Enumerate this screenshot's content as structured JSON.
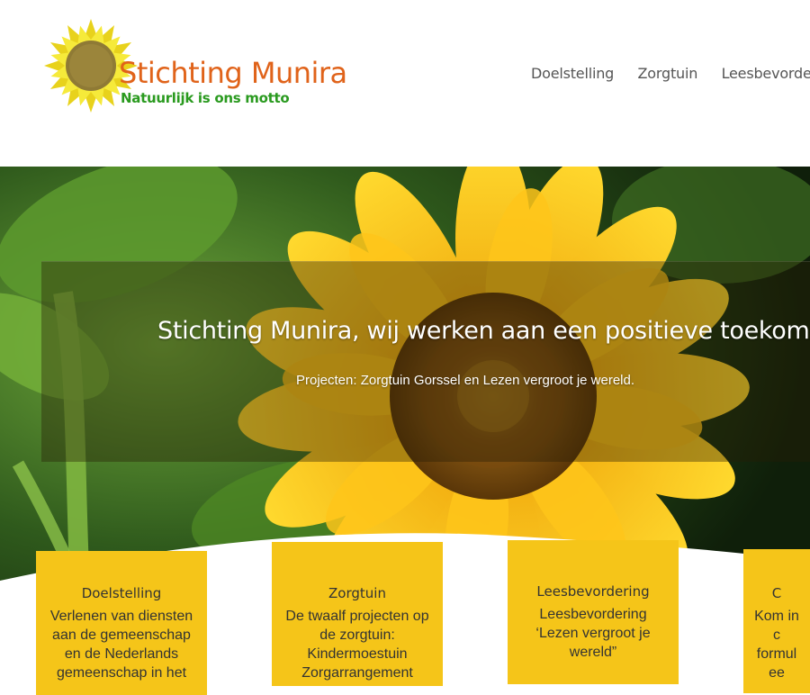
{
  "site": {
    "name": "Stichting Munira",
    "motto": "Natuurlijk is ons motto"
  },
  "nav": {
    "items": [
      "Doelstelling",
      "Zorgtuin",
      "Leesbevordering"
    ]
  },
  "hero": {
    "title": "Stichting Munira, wij werken aan een positieve toekomst.",
    "subtitle": "Projecten: Zorgtuin Gorssel en Lezen vergroot je wereld."
  },
  "cards": [
    {
      "title": "Doelstelling",
      "text": "Verlenen van diensten aan de gemeenschap en de Nederlands gemeenschap in het"
    },
    {
      "title": "Zorgtuin",
      "text": "De twaalf projecten op de zorgtuin: Kindermoestuin Zorgarrangement"
    },
    {
      "title": "Leesbevordering",
      "text": "Leesbevordering ‘Lezen vergroot je wereld”"
    },
    {
      "title": "C",
      "text": "Kom in c formul ee"
    }
  ],
  "colors": {
    "accent_orange": "#e0631a",
    "motto_green": "#2a9a1f",
    "card_yellow": "#f5c519"
  }
}
